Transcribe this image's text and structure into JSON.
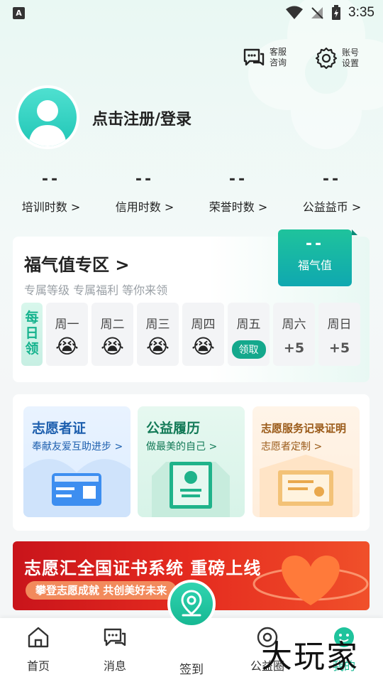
{
  "status_bar": {
    "time": "3:35",
    "indicator": "A"
  },
  "top_actions": {
    "service": {
      "line1": "客服",
      "line2": "咨询",
      "icon": "chat-icon"
    },
    "settings": {
      "line1": "账号",
      "line2": "设置",
      "icon": "gear-icon"
    }
  },
  "profile": {
    "login_text": "点击注册/登录"
  },
  "stats": [
    {
      "value": "--",
      "label": "培训时数 >"
    },
    {
      "value": "--",
      "label": "信用时数 >"
    },
    {
      "value": "--",
      "label": "荣誉时数 >"
    },
    {
      "value": "--",
      "label": "公益益币 >"
    }
  ],
  "blessing": {
    "title": "福气值专区 >",
    "subtitle": "专属等级 专属福利 等你来领",
    "badge_value": "--",
    "badge_label": "福气值",
    "daily_tag": "每日领",
    "days": [
      {
        "name": "周一",
        "status": "😭"
      },
      {
        "name": "周二",
        "status": "😭"
      },
      {
        "name": "周三",
        "status": "😭"
      },
      {
        "name": "周四",
        "status": "😭"
      },
      {
        "name": "周五",
        "status": "领取"
      },
      {
        "name": "周六",
        "status": "+5"
      },
      {
        "name": "周日",
        "status": "+5"
      }
    ]
  },
  "features": [
    {
      "title": "志愿者证",
      "subtitle": "奉献友爱互助进步 >"
    },
    {
      "title": "公益履历",
      "subtitle": "做最美的自己 >"
    },
    {
      "title": "志愿服务记录证明",
      "subtitle": "志愿者定制 >"
    }
  ],
  "banner": {
    "title": "志愿汇全国证书系统 重磅上线",
    "subtitle": "攀登志愿成就 共创美好未来"
  },
  "tabbar": {
    "home": "首页",
    "messages": "消息",
    "checkin": "签到",
    "public": "公益圈",
    "mine": "我的"
  },
  "watermark": "大玩家",
  "colors": {
    "accent": "#17b893",
    "banner": "#e52b1f"
  }
}
